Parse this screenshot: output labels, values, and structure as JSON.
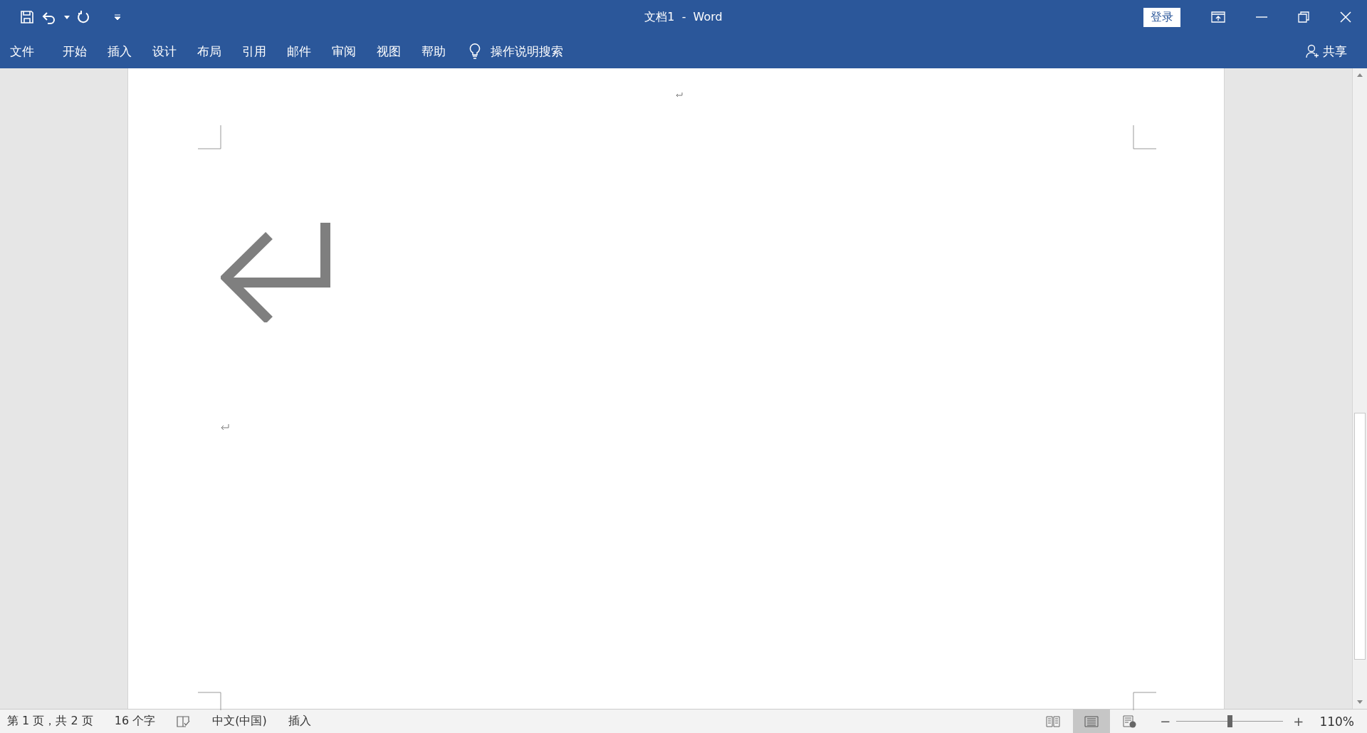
{
  "window": {
    "title": "文档1  -  Word",
    "sign_in": "登录"
  },
  "ribbon_tabs": [
    {
      "label": "文件",
      "selected": false
    },
    {
      "label": "开始",
      "selected": false
    },
    {
      "label": "插入",
      "selected": false
    },
    {
      "label": "设计",
      "selected": false
    },
    {
      "label": "布局",
      "selected": false
    },
    {
      "label": "引用",
      "selected": false
    },
    {
      "label": "邮件",
      "selected": false
    },
    {
      "label": "审阅",
      "selected": false
    },
    {
      "label": "视图",
      "selected": false
    },
    {
      "label": "帮助",
      "selected": false
    }
  ],
  "tell_me": {
    "placeholder": "操作说明搜索"
  },
  "share": "共享",
  "status_bar": {
    "page": "第 1 页，共 2 页",
    "words": "16 个字",
    "language": "中文(中国)",
    "mode": "插入",
    "views": [
      {
        "kind": "read",
        "selected": false
      },
      {
        "kind": "print",
        "selected": true
      },
      {
        "kind": "web",
        "selected": false
      }
    ],
    "zoom": {
      "minus": "−",
      "plus": "+",
      "level": 0.5,
      "reading": "110%"
    }
  }
}
